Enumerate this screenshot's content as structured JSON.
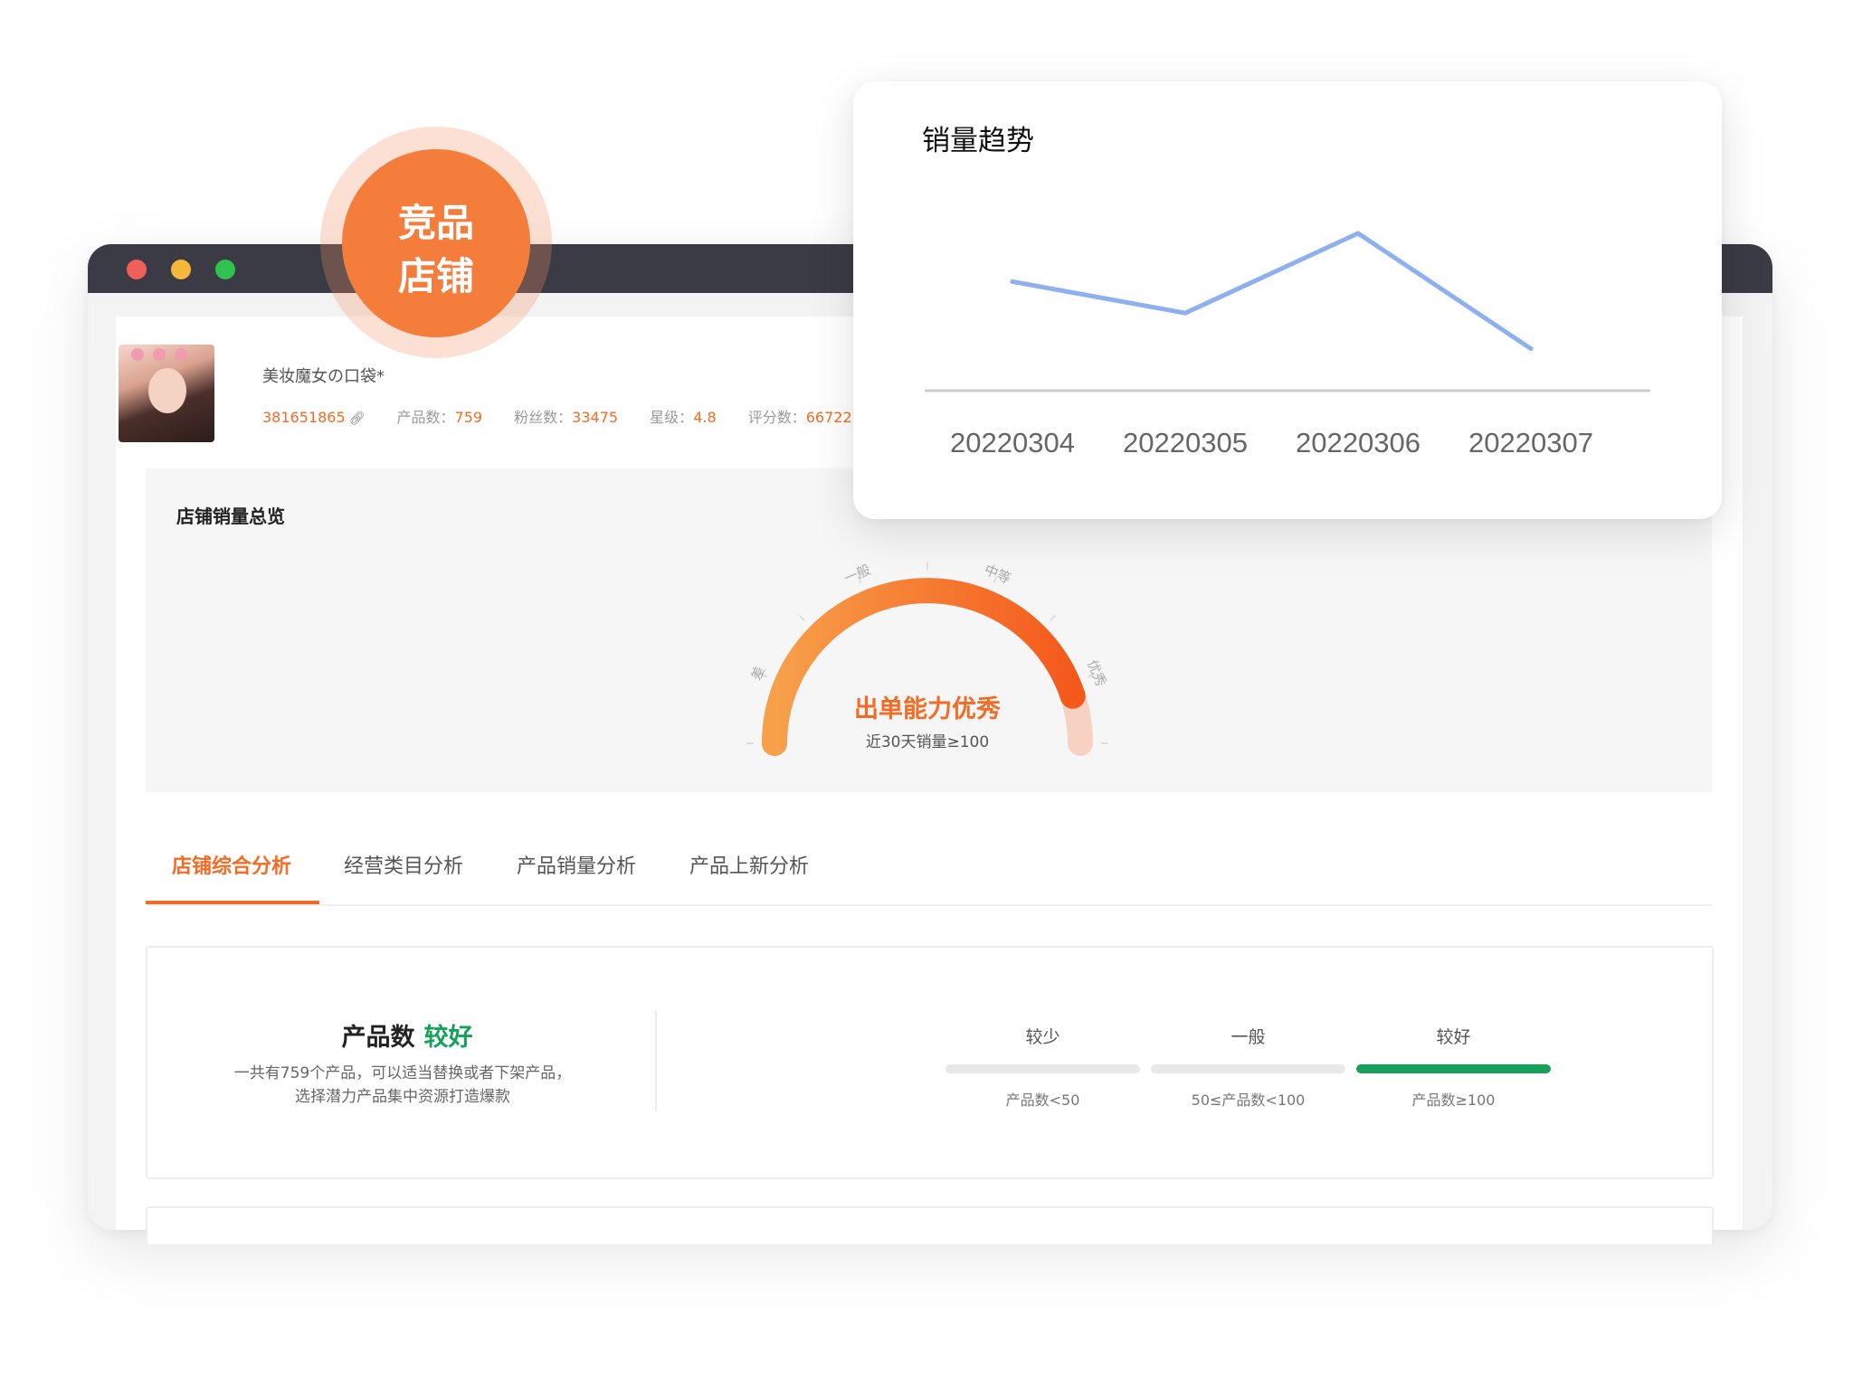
{
  "badge": {
    "line1": "竞品",
    "line2": "店铺"
  },
  "store": {
    "name": "美妆魔女の口袋*",
    "id": "381651865",
    "products_label": "产品数：",
    "products_value": "759",
    "fans_label": "粉丝数：",
    "fans_value": "33475",
    "stars_label": "星级：",
    "stars_value": "4.8",
    "reviews_label": "评分数：",
    "reviews_value": "66722"
  },
  "overview": {
    "title": "店铺销量总览",
    "gauge_ticks": [
      "差",
      "一般",
      "中等",
      "优秀"
    ],
    "gauge_main": "出单能力优秀",
    "gauge_sub": "近30天销量≥100",
    "level_fraction": 0.9
  },
  "tabs": [
    "店铺综合分析",
    "经营类目分析",
    "产品销量分析",
    "产品上新分析"
  ],
  "active_tab": 0,
  "metric": {
    "title": "产品数",
    "rating": "较好",
    "description": "一共有759个产品，可以适当替换或者下架产品，选择潜力产品集中资源打造爆款",
    "levels": [
      {
        "label": "较少",
        "condition": "产品数<50",
        "active": false
      },
      {
        "label": "一般",
        "condition": "50≤产品数<100",
        "active": false
      },
      {
        "label": "较好",
        "condition": "产品数≥100",
        "active": true
      }
    ]
  },
  "colors": {
    "accent": "#f36b24",
    "good": "#17a05a",
    "trend_line": "#8fb0ef"
  },
  "chart_data": {
    "type": "line",
    "title": "销量趋势",
    "categories": [
      "20220304",
      "20220305",
      "20220306",
      "20220307"
    ],
    "series": [
      {
        "values": [
          52,
          37,
          75,
          20
        ]
      }
    ],
    "ylim": [
      0,
      100
    ],
    "grid": false
  }
}
